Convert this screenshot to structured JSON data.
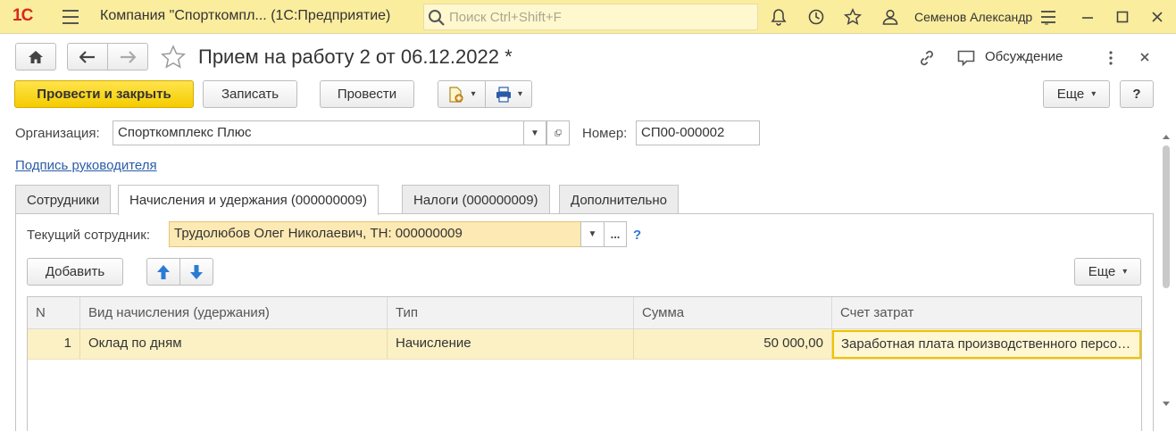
{
  "titlebar": {
    "logo": "1С",
    "app_title": "Компания \"Спорткомпл...  (1С:Предприятие)",
    "search_placeholder": "Поиск Ctrl+Shift+F",
    "user_name": "Семенов Александр",
    "icons": [
      "hamburger-menu-icon",
      "search-icon",
      "bell-icon",
      "history-icon",
      "star-icon",
      "users-icon",
      "settings-icon",
      "minimize-icon",
      "maximize-icon",
      "close-icon"
    ]
  },
  "form": {
    "title": "Прием на работу 2 от 06.12.2022 *",
    "discussion_label": "Обсуждение",
    "toolbar": {
      "post_and_close": "Провести и закрыть",
      "save": "Записать",
      "post": "Провести",
      "more": "Еще",
      "help": "?"
    },
    "organization_label": "Организация:",
    "organization_value": "Спорткомплекс Плюс",
    "number_label": "Номер:",
    "number_value": "СП00-000002",
    "signature_link": "Подпись руководителя"
  },
  "tabs": [
    {
      "label": "Сотрудники",
      "active": false
    },
    {
      "label": "Начисления и удержания (000000009)",
      "active": true
    },
    {
      "label": "Налоги (000000009)",
      "active": false
    },
    {
      "label": "Дополнительно",
      "active": false
    }
  ],
  "panel": {
    "current_employee_label": "Текущий сотрудник:",
    "current_employee_value": "Трудолюбов Олег Николаевич, ТН: 000000009",
    "help_mark": "?",
    "add_button": "Добавить",
    "more_button": "Еще"
  },
  "table": {
    "columns": [
      "N",
      "Вид начисления (удержания)",
      "Тип",
      "Сумма",
      "Счет затрат"
    ],
    "rows": [
      [
        "1",
        "Оклад по дням",
        "Начисление",
        "50 000,00",
        "Заработная плата производственного персонала"
      ]
    ]
  },
  "colors": {
    "titlebar_bg": "#fbed9e",
    "primary_button": "#f5cc00",
    "selected_row": "#fbf1c4",
    "current_cell_border": "#f0c200",
    "link": "#2a5ca8",
    "accent_arrow": "#2a7bd4"
  }
}
